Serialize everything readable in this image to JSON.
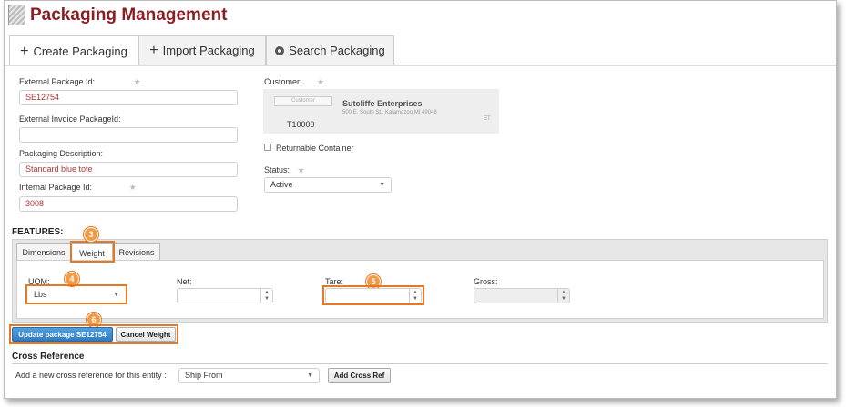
{
  "app": {
    "title": "Packaging Management"
  },
  "tabs": [
    {
      "label": "Create Packaging",
      "icon": "plus-icon"
    },
    {
      "label": "Import Packaging",
      "icon": "plus-icon"
    },
    {
      "label": "Search Packaging",
      "icon": "search-circle-icon"
    }
  ],
  "form": {
    "external_package_id": {
      "label": "External Package Id:",
      "value": "SE12754"
    },
    "external_invoice_package_id": {
      "label": "External Invoice PackageId:",
      "value": ""
    },
    "packaging_description": {
      "label": "Packaging Description:",
      "value": "Standard blue tote"
    },
    "internal_package_id": {
      "label": "Internal Package Id:",
      "value": "3008"
    },
    "customer": {
      "label": "Customer:",
      "badge": "Customer",
      "code": "T10000",
      "name": "Sutcliffe Enterprises",
      "address": "500 E. South St., Kalamazoo MI 49048",
      "timezone": "ET"
    },
    "returnable_container": {
      "label": "Returnable Container",
      "checked": false
    },
    "status": {
      "label": "Status:",
      "value": "Active"
    },
    "required_marker": "★"
  },
  "features": {
    "heading": "FEATURES:",
    "tabs": [
      {
        "label": "Dimensions"
      },
      {
        "label": "Weight"
      },
      {
        "label": "Revisions"
      }
    ],
    "active_tab": "Weight",
    "uom": {
      "label": "UOM:",
      "value": "Lbs"
    },
    "net": {
      "label": "Net:",
      "value": ""
    },
    "tare": {
      "label": "Tare:",
      "value": ""
    },
    "gross": {
      "label": "Gross:",
      "value": ""
    }
  },
  "callouts": [
    "3",
    "4",
    "5",
    "6"
  ],
  "buttons": {
    "update": "Update package SE12754",
    "cancel": "Cancel Weight"
  },
  "cross_reference": {
    "heading": "Cross Reference",
    "prompt": "Add a new cross reference for this entity :",
    "select_value": "Ship From",
    "add_button": "Add Cross Ref"
  },
  "colors": {
    "title": "#8b1e24",
    "highlight": "#e87722",
    "primary_button": "#2f7bc2"
  }
}
